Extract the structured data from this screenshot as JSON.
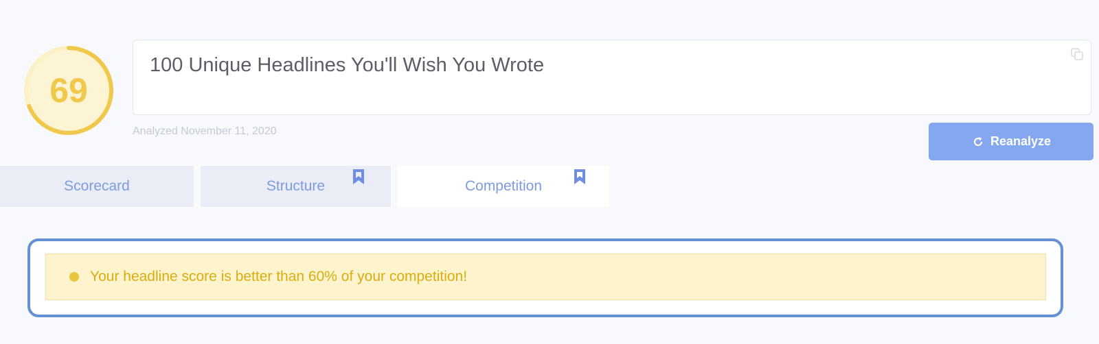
{
  "score": {
    "value": "69",
    "fraction": 0.69,
    "color": "#f0c84c"
  },
  "headline": {
    "text": "100 Unique Headlines You'll Wish You Wrote",
    "copy_icon": "copy-icon"
  },
  "analyzed": {
    "date_label": "Analyzed November 11, 2020"
  },
  "actions": {
    "reanalyze_label": "Reanalyze",
    "reanalyze_icon": "refresh-icon"
  },
  "tabs": [
    {
      "label": "Scorecard",
      "active": false,
      "bookmarked": false
    },
    {
      "label": "Structure",
      "active": false,
      "bookmarked": true
    },
    {
      "label": "Competition",
      "active": true,
      "bookmarked": true
    }
  ],
  "competition": {
    "message": "Your headline score is better than 60% of your competition!",
    "status_color": "#e8c43f"
  },
  "colors": {
    "accent": "#7f9be0",
    "button": "#85a7ef",
    "card_border": "#6690d4"
  }
}
